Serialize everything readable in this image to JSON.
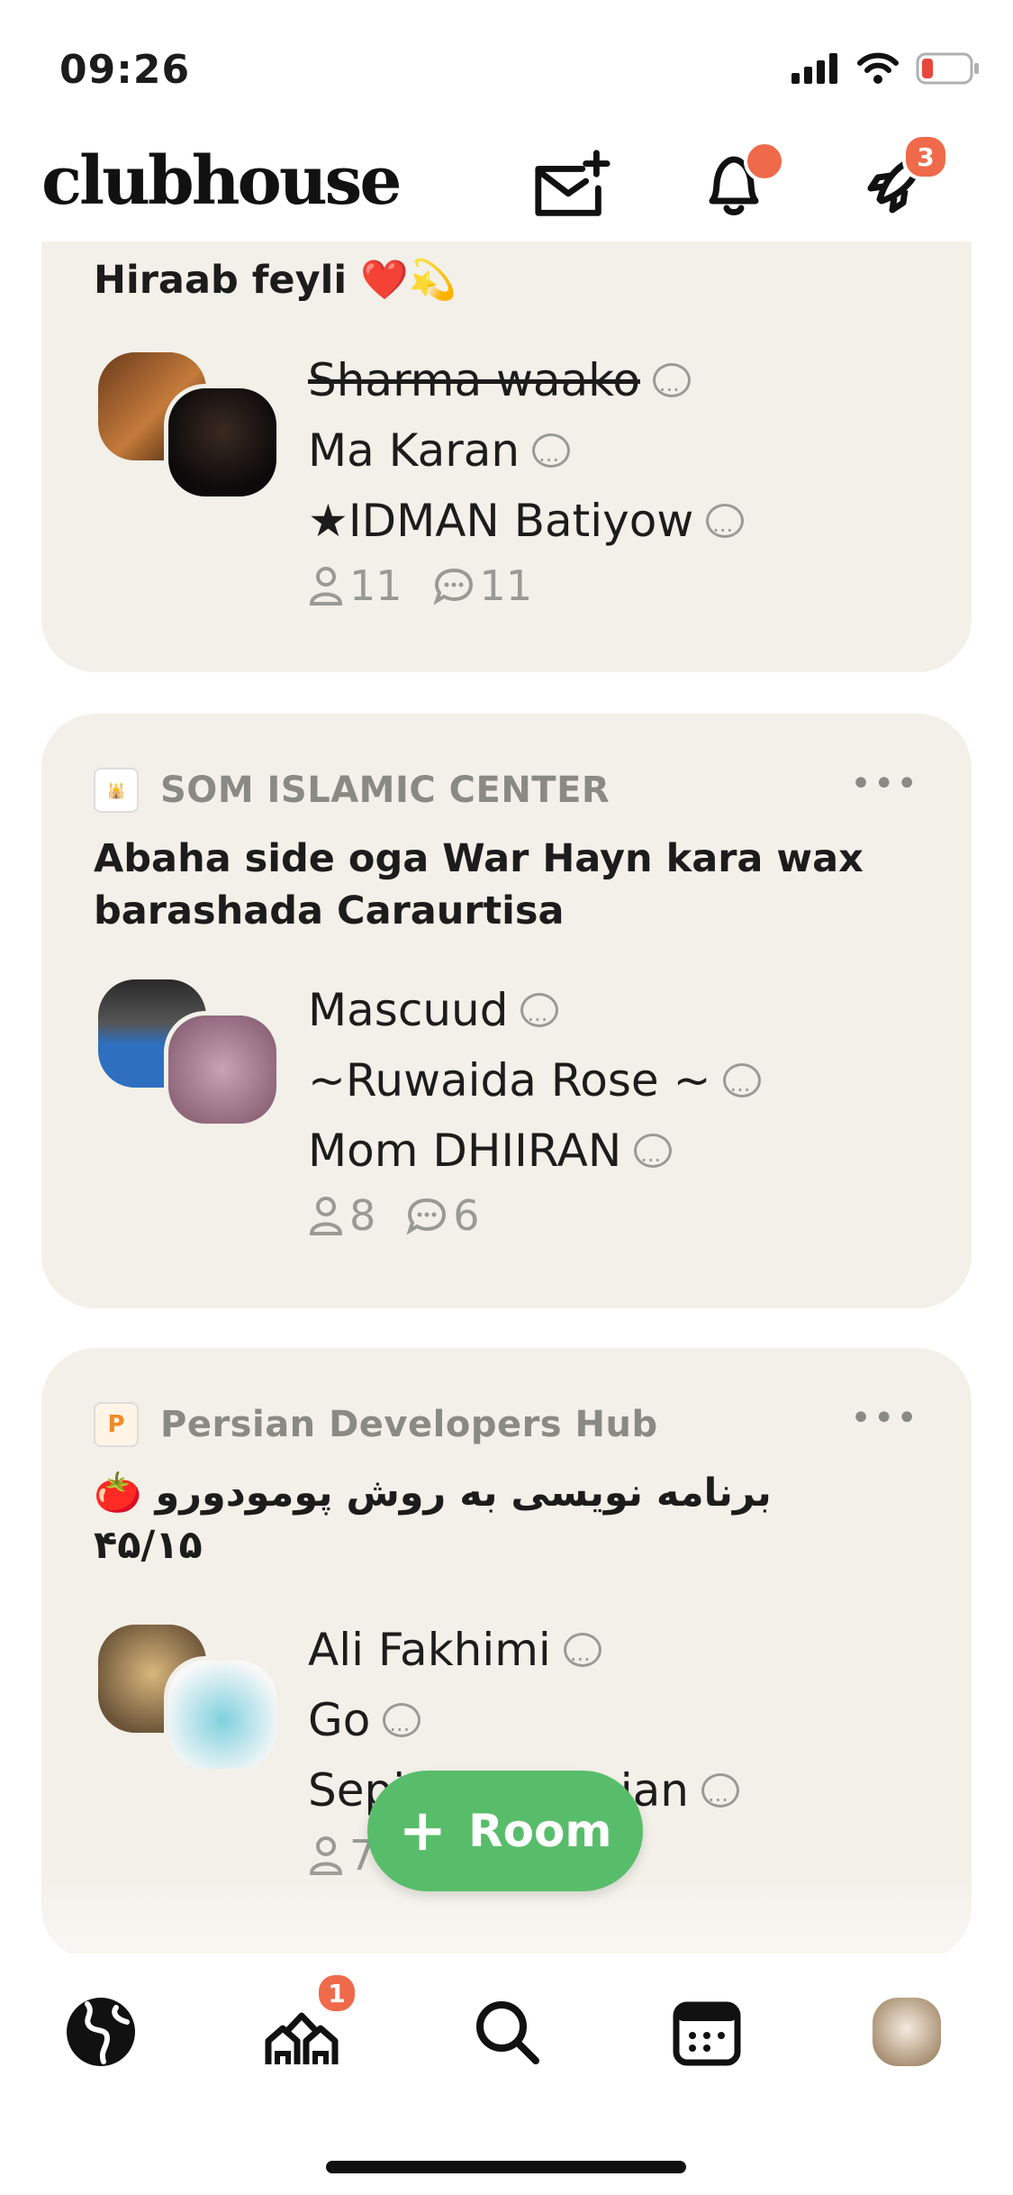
{
  "status_bar": {
    "time": "09:26"
  },
  "header": {
    "logo": "clubhouse",
    "notifications_badge": "",
    "activity_badge": "3"
  },
  "rooms": [
    {
      "club_name": "",
      "title": "Hiraab feyli ❤️💫",
      "speakers": [
        "Sharma waako",
        "Ma Karan",
        "IDMAN Batiyow"
      ],
      "speaker_prefix_3": "★",
      "listener_count": "11",
      "speaker_count": "11"
    },
    {
      "club_name": "SOM ISLAMIC CENTER",
      "title": "Abaha side oga War Hayn kara wax barashada Caraurtisa",
      "speakers": [
        "Mascuud",
        "~Ruwaida Rose ~",
        "Mom DHIIRAN"
      ],
      "listener_count": "8",
      "speaker_count": "6"
    },
    {
      "club_name": "Persian Developers Hub",
      "title": "🍅 برنامه نویسی به روش پومودورو ۴۵/۱۵",
      "speakers": [
        "Ali Fakhimi",
        "Go",
        "Sepideh Aminian"
      ],
      "listener_count": "7",
      "speaker_count": ""
    }
  ],
  "fab": {
    "label": "Room"
  },
  "nav": {
    "houses_badge": "1"
  },
  "colors": {
    "card_bg": "#f2f0e8",
    "accent_green": "#58bd6b",
    "badge_orange": "#ef6a4a"
  }
}
